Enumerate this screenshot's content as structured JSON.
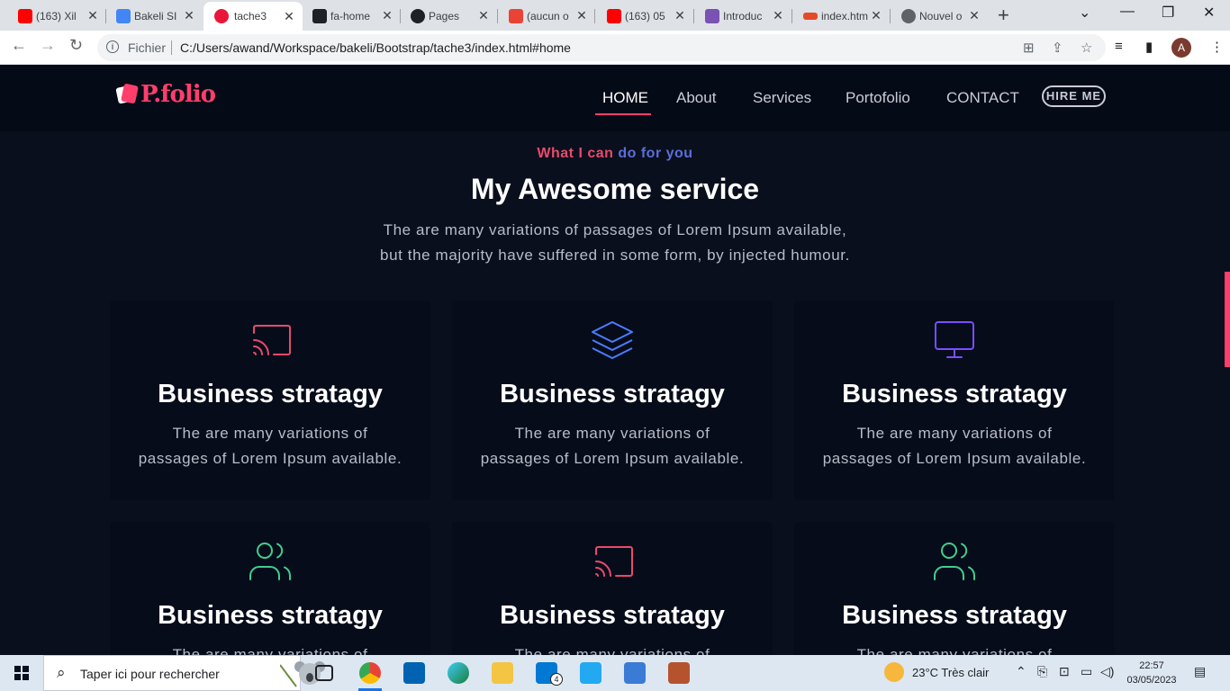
{
  "browser": {
    "tabs": [
      {
        "label": "(163) Xil",
        "favicon_color": "#ff0000"
      },
      {
        "label": "Bakeli SI",
        "favicon_color": "#4285f4"
      },
      {
        "label": "tache3",
        "favicon_color": "#e8173a"
      },
      {
        "label": "fa-home",
        "favicon_color": "#202124"
      },
      {
        "label": "Pages",
        "favicon_color": "#202124"
      },
      {
        "label": "(aucun o",
        "favicon_color": "#ea4335"
      },
      {
        "label": "(163) 05",
        "favicon_color": "#ff0000"
      },
      {
        "label": "Introduc",
        "favicon_color": "#7952b3"
      },
      {
        "label": "index.htm",
        "favicon_color": "#e34c26"
      },
      {
        "label": "Nouvel o",
        "favicon_color": "#5f6368"
      }
    ],
    "new_tab": "+",
    "address": {
      "scheme_label": "Fichier",
      "url": "C:/Users/awand/Workspace/bakeli/Bootstrap/tache3/index.html#home"
    },
    "profile_initial": "A"
  },
  "site": {
    "logo_text": "P.folio",
    "nav": [
      "HOME",
      "About",
      "Services",
      "Portofolio",
      "CONTACT"
    ],
    "hire_button": "HIRE ME",
    "section": {
      "eyebrow_part1": "What I can ",
      "eyebrow_part2": "do for you",
      "title": "My Awesome service",
      "intro_line1": "The are many variations of passages of Lorem Ipsum available,",
      "intro_line2": "but the majority have suffered in some form, by injected humour."
    },
    "cards": [
      {
        "icon": "cast-icon",
        "icon_color": "#e94a6b",
        "title": "Business stratagy",
        "text1": "The are many variations of",
        "text2": "passages of Lorem Ipsum available."
      },
      {
        "icon": "layers-icon",
        "icon_color": "#4a7dff",
        "title": "Business stratagy",
        "text1": "The are many variations of",
        "text2": "passages of Lorem Ipsum available."
      },
      {
        "icon": "monitor-icon",
        "icon_color": "#7b4dff",
        "title": "Business stratagy",
        "text1": "The are many variations of",
        "text2": "passages of Lorem Ipsum available."
      },
      {
        "icon": "users-icon",
        "icon_color": "#3ecf8e",
        "title": "Business stratagy",
        "text1": "The are many variations of",
        "text2": ""
      },
      {
        "icon": "cast-icon",
        "icon_color": "#e94a6b",
        "title": "Business stratagy",
        "text1": "The are many variations of",
        "text2": ""
      },
      {
        "icon": "users-icon",
        "icon_color": "#3ecf8e",
        "title": "Business stratagy",
        "text1": "The are many variations of",
        "text2": ""
      }
    ]
  },
  "taskbar": {
    "search_placeholder": "Taper ici pour rechercher",
    "weather": "23°C  Très clair",
    "time": "22:57",
    "date": "03/05/2023",
    "mail_badge": "4"
  }
}
